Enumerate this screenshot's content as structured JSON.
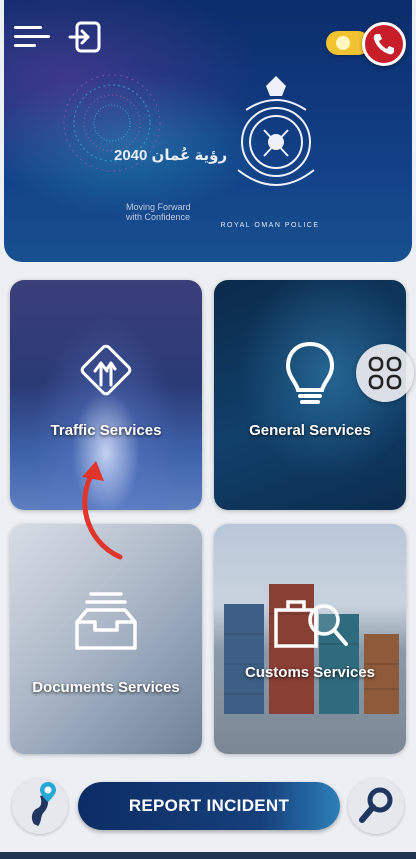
{
  "header": {
    "vision_logo_text": "رؤية عُمان 2040",
    "vision_tagline": "Moving Forward with Confidence",
    "police_logo_text": "ROYAL OMAN POLICE",
    "icons": [
      "menu-icon",
      "exit-icon",
      "phone-icon"
    ]
  },
  "tiles": [
    {
      "label": "Traffic Services",
      "icon": "traffic-sign-icon"
    },
    {
      "label": "General Services",
      "icon": "lightbulb-icon"
    },
    {
      "label": "Documents Services",
      "icon": "document-tray-icon"
    },
    {
      "label": "Customs Services",
      "icon": "customs-search-icon"
    }
  ],
  "bottom_bar": {
    "report_label": "REPORT INCIDENT",
    "icons": [
      "map-pin-icon",
      "search-icon"
    ]
  },
  "colors": {
    "header_blue": "#0b2d6b",
    "accent_yellow": "#f0c431",
    "call_red": "#c81e2a",
    "report_blue": "#0c2c64"
  }
}
